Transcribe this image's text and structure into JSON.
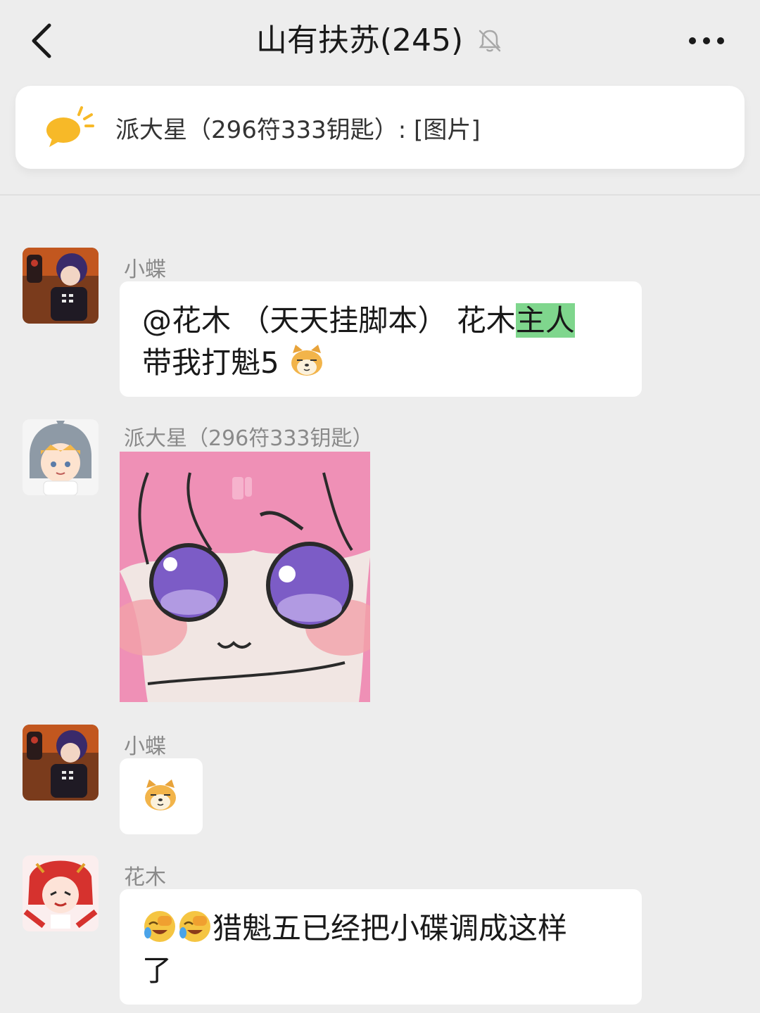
{
  "header": {
    "title": "山有扶苏(245)",
    "back_icon": "chevron-left-icon",
    "mute_icon": "bell-off-icon",
    "more_icon": "ellipsis-icon"
  },
  "notice": {
    "icon": "speech-bubble-icon",
    "text": "派大星（296符333钥匙）: [图片]"
  },
  "messages": [
    {
      "sender": "小蝶",
      "text_prefix": "@花木 （天天挂脚本） 花木",
      "highlight": "主人",
      "text_line2": "带我打魁5",
      "emoji": "doge-emoji"
    },
    {
      "sender": "派大星（296符333钥匙）",
      "type": "image",
      "image_desc_icon": "anime-girl-sticker"
    },
    {
      "sender": "小蝶",
      "emoji": "doge-emoji"
    },
    {
      "sender": "花木",
      "text_line1": "猎魁五已经把小碟调成这样",
      "text_line2": "了",
      "emoji": "facepalm-laugh-emoji"
    }
  ],
  "colors": {
    "background": "#ededed",
    "bubble": "#ffffff",
    "highlight": "#7fd68d",
    "notice_icon": "#f7b928"
  }
}
